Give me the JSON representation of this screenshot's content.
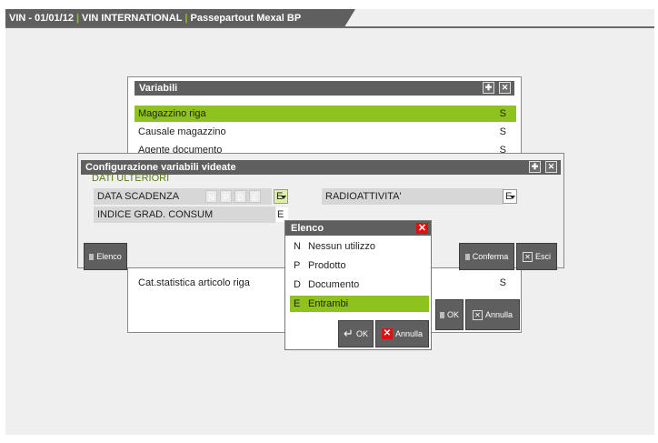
{
  "titlebar": {
    "part1": "VIN - 01/01/12",
    "part2": "VIN INTERNATIONAL",
    "part3": "Passepartout Mexal BP"
  },
  "variabili": {
    "title": "Variabili",
    "rows": [
      {
        "label": "Magazzino riga",
        "value": "S"
      },
      {
        "label": "Causale magazzino",
        "value": "S"
      },
      {
        "label": "Agente documento",
        "value": "S"
      }
    ],
    "bottom_row": {
      "label": "Cat.statistica articolo riga",
      "value": "S"
    },
    "ok_label": "OK",
    "annulla_label": "Annulla"
  },
  "config": {
    "title": "Configurazione variabili videate",
    "section": "DATI ULTERIORI",
    "data_scadenza_label": "DATA SCADENZA",
    "option_boxes": [
      "N",
      "P",
      "D",
      "E"
    ],
    "data_scadenza_value": "E",
    "radio_label": "RADIOATTIVITA'",
    "radio_value": "E",
    "indice_label": "INDICE GRAD. CONSUM",
    "indice_value": "E",
    "elenco_button": "Elenco",
    "conferma_button": "Conferma",
    "esci_button": "Esci"
  },
  "elenco": {
    "title": "Elenco",
    "items": [
      {
        "code": "N",
        "label": "Nessun utilizzo"
      },
      {
        "code": "P",
        "label": "Prodotto"
      },
      {
        "code": "D",
        "label": "Documento"
      },
      {
        "code": "E",
        "label": "Entrambi"
      }
    ],
    "ok_label": "OK",
    "annulla_label": "Annulla"
  },
  "colors": {
    "accent": "#8dc21f",
    "header": "#5f5f5f",
    "close": "#e01010"
  }
}
